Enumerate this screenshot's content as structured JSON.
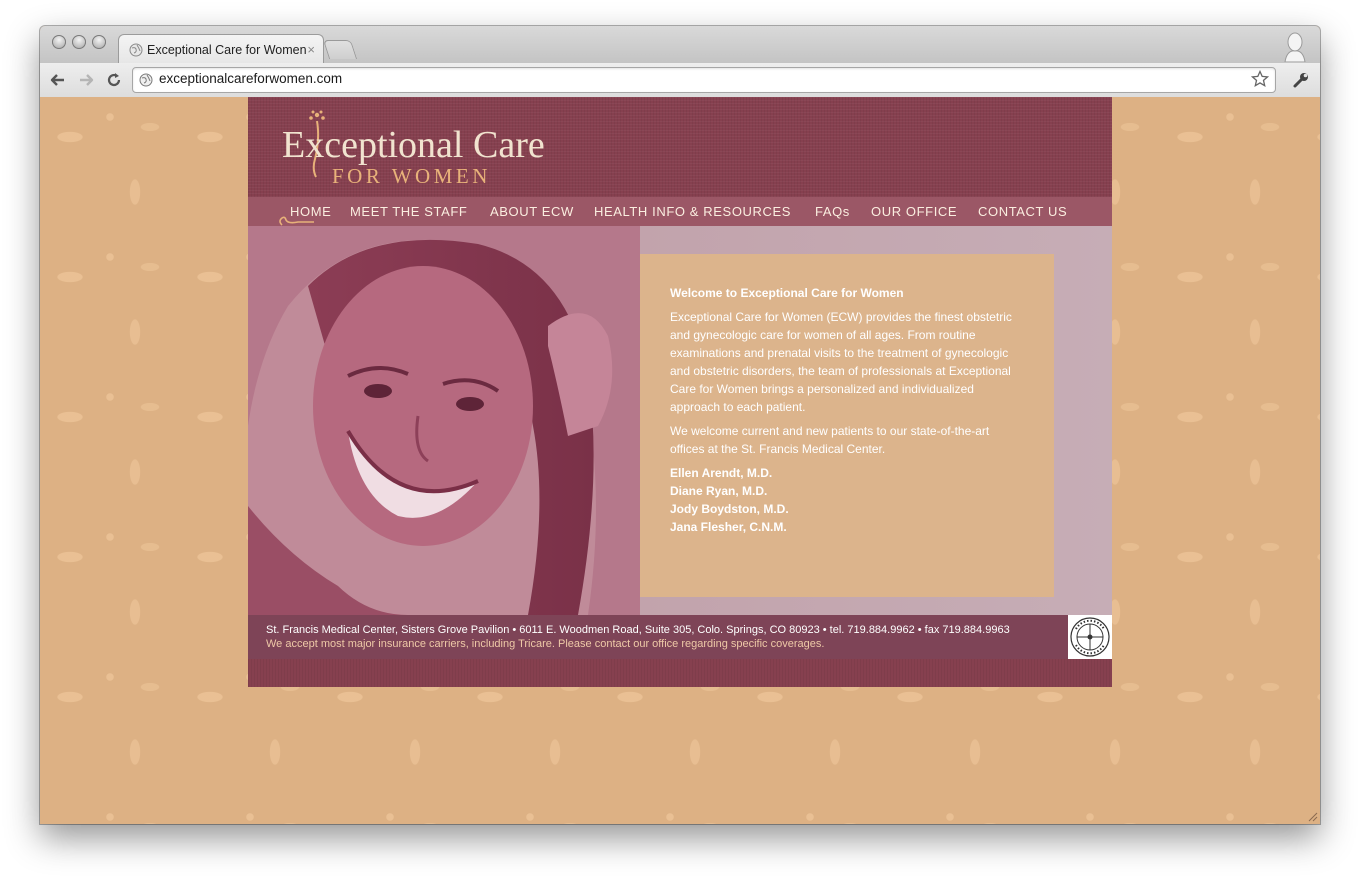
{
  "browser": {
    "tab_title": "Exceptional Care for Women",
    "tab_close": "×",
    "url": "exceptionalcareforwomen.com"
  },
  "site": {
    "logo": {
      "line1": "Exceptional Care",
      "line2": "FOR WOMEN"
    },
    "nav": [
      {
        "label": "HOME"
      },
      {
        "label": "MEET THE STAFF"
      },
      {
        "label": "ABOUT ECW"
      },
      {
        "label": "HEALTH INFO & RESOURCES"
      },
      {
        "label": "FAQs"
      },
      {
        "label": "OUR OFFICE"
      },
      {
        "label": "CONTACT US"
      }
    ],
    "welcome": {
      "title": "Welcome to Exceptional Care for Women",
      "paragraph1": "Exceptional Care for Women (ECW) provides the finest obstetric and gynecologic care for women of all ages. From routine examinations and prenatal visits to the treatment of gynecologic and obstetric disorders, the team of professionals at Exceptional Care for Women brings a personalized and individualized approach to each patient.",
      "paragraph2": "We welcome current and new patients to our state-of-the-art offices at the St. Francis Medical Center.",
      "doctors": [
        "Ellen Arendt, M.D.",
        "Diane Ryan, M.D.",
        "Jody Boydston, M.D.",
        "Jana Flesher, C.N.M."
      ]
    },
    "footer": {
      "address": "St. Francis Medical Center, Sisters Grove Pavilion • 6011 E. Woodmen Road, Suite 305, Colo. Springs, CO 80923 • tel. 719.884.9962 • fax 719.884.9963",
      "insurance": "We accept most major insurance carriers, including Tricare. Please contact our office regarding specific coverages.",
      "seal_text": "AAAHC"
    },
    "colors": {
      "background": "#ddb184",
      "header": "#86404f",
      "navbar": "#9b5766",
      "panel": "#dcb48c",
      "footer": "#7e4457"
    }
  }
}
